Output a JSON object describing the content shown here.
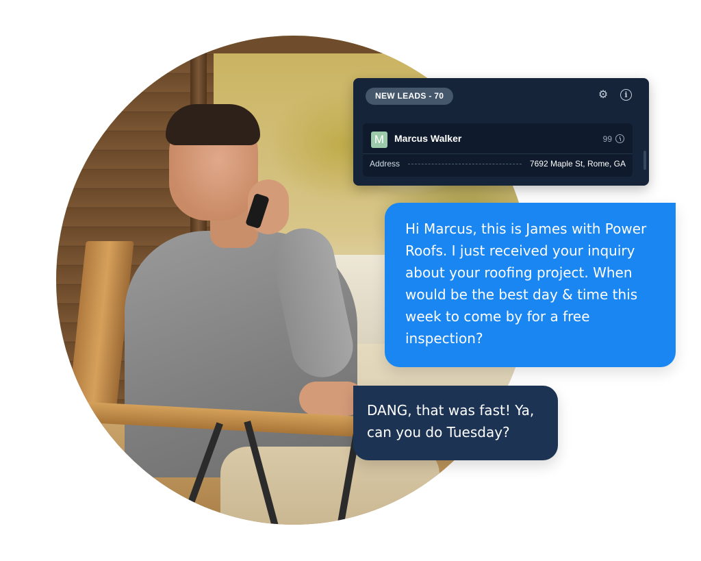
{
  "lead_panel": {
    "badge": "NEW LEADS - 70",
    "gear_icon": "gear-icon",
    "info_icon": "info-icon",
    "lead": {
      "avatar_initial": "M",
      "avatar_color": "#9ccbab",
      "name": "Marcus Walker",
      "score": "99",
      "address_label": "Address",
      "address_value": "7692 Maple St, Rome, GA"
    }
  },
  "messages": {
    "outgoing": {
      "text": "Hi Marcus, this is James with Power Roofs. I just received your inquiry about your roofing project. When would be the best day & time this week to come by for a free inspection?",
      "color": "#1a86f2"
    },
    "incoming": {
      "text": "DANG, that was fast! Ya, can you do Tuesday?",
      "color": "#1c3354"
    }
  }
}
